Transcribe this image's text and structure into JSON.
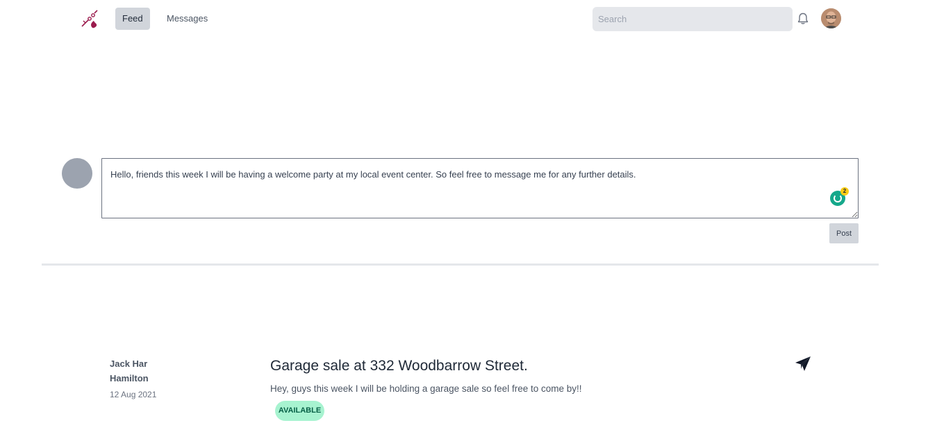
{
  "nav": {
    "tabs": [
      {
        "label": "Feed",
        "active": true
      },
      {
        "label": "Messages",
        "active": false
      }
    ],
    "search": {
      "placeholder": "Search",
      "value": ""
    },
    "icons": {
      "logo": "brand-logo-icon",
      "notifications": "bell-icon",
      "profile": "user-avatar"
    }
  },
  "composer": {
    "text": "Hello, friends this week I will be having a welcome party at my local event center. So feel free to message me for any further details.",
    "grammarly_count": "2",
    "post_label": "Post"
  },
  "feed": {
    "items": [
      {
        "author_first": "Jack Har",
        "author_last": "Hamilton",
        "date": "12 Aug 2021",
        "title": "Garage sale at 332 Woodbarrow Street.",
        "body": "Hey, guys this week I will be holding a garage sale so feel free to come by!!",
        "status": "AVAILABLE",
        "action_icon": "send-icon"
      }
    ]
  },
  "colors": {
    "accent": "#9b1b4d",
    "status_bg": "#a7f3d0",
    "status_text": "#065f46",
    "active_tab_bg": "#d1d5db"
  }
}
